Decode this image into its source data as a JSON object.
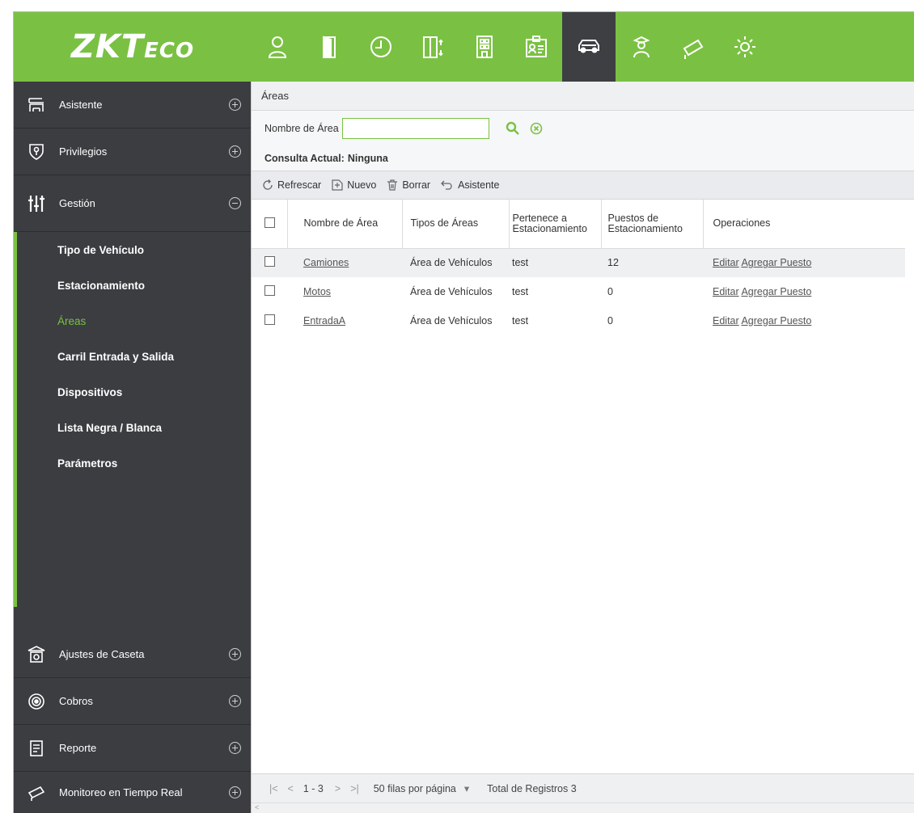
{
  "brand": {
    "logo_main": "ZKT",
    "logo_sub": "ECO",
    "accent": "#7ac143",
    "dark": "#3b3d41"
  },
  "modules": [
    {
      "icon": "person-icon"
    },
    {
      "icon": "door-icon"
    },
    {
      "icon": "clock-icon"
    },
    {
      "icon": "elevator-icon"
    },
    {
      "icon": "building-icon"
    },
    {
      "icon": "badge-icon"
    },
    {
      "icon": "car-icon",
      "active": true
    },
    {
      "icon": "guard-icon"
    },
    {
      "icon": "camera-icon"
    },
    {
      "icon": "settings-icon"
    }
  ],
  "sidebar": {
    "top": [
      {
        "label": "Asistente",
        "icon": "signpost-icon",
        "state": "expand"
      },
      {
        "label": "Privilegios",
        "icon": "shield-icon",
        "state": "expand"
      },
      {
        "label": "Gestión",
        "icon": "sliders-icon",
        "state": "collapse"
      }
    ],
    "sub": [
      {
        "label": "Tipo de Vehículo"
      },
      {
        "label": "Estacionamiento"
      },
      {
        "label": "Áreas",
        "active": true
      },
      {
        "label": "Carril Entrada y Salida"
      },
      {
        "label": "Dispositivos"
      },
      {
        "label": "Lista Negra / Blanca"
      },
      {
        "label": "Parámetros"
      }
    ],
    "bottom": [
      {
        "label": "Ajustes de Caseta",
        "icon": "booth-icon"
      },
      {
        "label": "Cobros",
        "icon": "coin-icon"
      },
      {
        "label": "Reporte",
        "icon": "report-icon"
      },
      {
        "label": "Monitoreo en Tiempo Real",
        "icon": "monitor-icon"
      }
    ]
  },
  "main": {
    "breadcrumb": "Áreas",
    "search": {
      "label": "Nombre de Área",
      "value": ""
    },
    "current_query": {
      "label": "Consulta Actual:",
      "value": "Ninguna"
    },
    "toolbar": {
      "refresh": "Refrescar",
      "new": "Nuevo",
      "delete": "Borrar",
      "wizard": "Asistente"
    },
    "table": {
      "headers": [
        "Nombre de Área",
        "Tipos de Áreas",
        "Pertenece a Estacionamiento",
        "Puestos de Estacionamiento",
        "Operaciones"
      ],
      "rows": [
        {
          "name": "Camiones",
          "type": "Área de Vehículos",
          "parking": "test",
          "spots": "12",
          "op_edit": "Editar",
          "op_add": "Agregar Puesto"
        },
        {
          "name": "Motos",
          "type": "Área de Vehículos",
          "parking": "test",
          "spots": "0",
          "op_edit": "Editar",
          "op_add": "Agregar Puesto"
        },
        {
          "name": "EntradaA",
          "type": "Área de Vehículos",
          "parking": "test",
          "spots": "0",
          "op_edit": "Editar",
          "op_add": "Agregar Puesto"
        }
      ]
    },
    "pager": {
      "first": "|<",
      "prev": "<",
      "range": "1 - 3",
      "next": ">",
      "last": ">|",
      "per_page": "50 filas por página",
      "dropdown": "▾",
      "total": "Total de Registros 3"
    },
    "scroll_hint": "<"
  }
}
